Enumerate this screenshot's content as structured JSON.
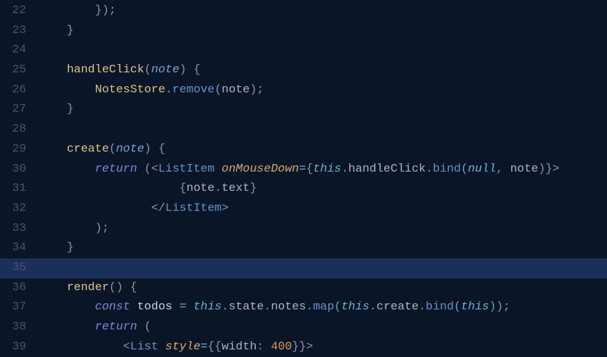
{
  "editor": {
    "first_line_number": 22,
    "highlighted_line_index": 13,
    "lines": [
      [
        {
          "t": "        });",
          "c": "tk-punc"
        }
      ],
      [
        {
          "t": "    }",
          "c": "tk-brace"
        }
      ],
      [],
      [
        {
          "t": "    ",
          "c": "tk-default"
        },
        {
          "t": "handleClick",
          "c": "tk-func"
        },
        {
          "t": "(",
          "c": "tk-punc"
        },
        {
          "t": "note",
          "c": "tk-param"
        },
        {
          "t": ") {",
          "c": "tk-punc"
        }
      ],
      [
        {
          "t": "        ",
          "c": "tk-default"
        },
        {
          "t": "NotesStore",
          "c": "tk-class"
        },
        {
          "t": ".",
          "c": "tk-punc"
        },
        {
          "t": "remove",
          "c": "tk-method"
        },
        {
          "t": "(",
          "c": "tk-punc"
        },
        {
          "t": "note",
          "c": "tk-prop"
        },
        {
          "t": ");",
          "c": "tk-punc"
        }
      ],
      [
        {
          "t": "    }",
          "c": "tk-brace"
        }
      ],
      [],
      [
        {
          "t": "    ",
          "c": "tk-default"
        },
        {
          "t": "create",
          "c": "tk-func"
        },
        {
          "t": "(",
          "c": "tk-punc"
        },
        {
          "t": "note",
          "c": "tk-param"
        },
        {
          "t": ") {",
          "c": "tk-punc"
        }
      ],
      [
        {
          "t": "        ",
          "c": "tk-default"
        },
        {
          "t": "return",
          "c": "tk-kw"
        },
        {
          "t": " (",
          "c": "tk-punc"
        },
        {
          "t": "<",
          "c": "tk-tagp"
        },
        {
          "t": "ListItem",
          "c": "tk-tag"
        },
        {
          "t": " ",
          "c": "tk-default"
        },
        {
          "t": "onMouseDown",
          "c": "tk-attr"
        },
        {
          "t": "=",
          "c": "tk-op"
        },
        {
          "t": "{",
          "c": "tk-punc"
        },
        {
          "t": "this",
          "c": "tk-this"
        },
        {
          "t": ".",
          "c": "tk-punc"
        },
        {
          "t": "handleClick",
          "c": "tk-prop"
        },
        {
          "t": ".",
          "c": "tk-punc"
        },
        {
          "t": "bind",
          "c": "tk-method"
        },
        {
          "t": "(",
          "c": "tk-punc"
        },
        {
          "t": "null",
          "c": "tk-null"
        },
        {
          "t": ", ",
          "c": "tk-punc"
        },
        {
          "t": "note",
          "c": "tk-prop"
        },
        {
          "t": ")}",
          "c": "tk-punc"
        },
        {
          "t": ">",
          "c": "tk-tagp"
        }
      ],
      [
        {
          "t": "                    {",
          "c": "tk-punc"
        },
        {
          "t": "note",
          "c": "tk-prop"
        },
        {
          "t": ".",
          "c": "tk-punc"
        },
        {
          "t": "text",
          "c": "tk-prop"
        },
        {
          "t": "}",
          "c": "tk-punc"
        }
      ],
      [
        {
          "t": "                ",
          "c": "tk-default"
        },
        {
          "t": "</",
          "c": "tk-tagp"
        },
        {
          "t": "ListItem",
          "c": "tk-tag"
        },
        {
          "t": ">",
          "c": "tk-tagp"
        }
      ],
      [
        {
          "t": "        );",
          "c": "tk-punc"
        }
      ],
      [
        {
          "t": "    }",
          "c": "tk-brace"
        }
      ],
      [],
      [
        {
          "t": "    ",
          "c": "tk-default"
        },
        {
          "t": "render",
          "c": "tk-func"
        },
        {
          "t": "() {",
          "c": "tk-punc"
        }
      ],
      [
        {
          "t": "        ",
          "c": "tk-default"
        },
        {
          "t": "const",
          "c": "tk-const"
        },
        {
          "t": " ",
          "c": "tk-default"
        },
        {
          "t": "todos",
          "c": "tk-var"
        },
        {
          "t": " ",
          "c": "tk-default"
        },
        {
          "t": "=",
          "c": "tk-op"
        },
        {
          "t": " ",
          "c": "tk-default"
        },
        {
          "t": "this",
          "c": "tk-this"
        },
        {
          "t": ".",
          "c": "tk-punc"
        },
        {
          "t": "state",
          "c": "tk-prop"
        },
        {
          "t": ".",
          "c": "tk-punc"
        },
        {
          "t": "notes",
          "c": "tk-prop"
        },
        {
          "t": ".",
          "c": "tk-punc"
        },
        {
          "t": "map",
          "c": "tk-method"
        },
        {
          "t": "(",
          "c": "tk-punc"
        },
        {
          "t": "this",
          "c": "tk-this"
        },
        {
          "t": ".",
          "c": "tk-punc"
        },
        {
          "t": "create",
          "c": "tk-prop"
        },
        {
          "t": ".",
          "c": "tk-punc"
        },
        {
          "t": "bind",
          "c": "tk-method"
        },
        {
          "t": "(",
          "c": "tk-punc"
        },
        {
          "t": "this",
          "c": "tk-this"
        },
        {
          "t": "));",
          "c": "tk-punc"
        }
      ],
      [
        {
          "t": "        ",
          "c": "tk-default"
        },
        {
          "t": "return",
          "c": "tk-kw"
        },
        {
          "t": " (",
          "c": "tk-punc"
        }
      ],
      [
        {
          "t": "            ",
          "c": "tk-default"
        },
        {
          "t": "<",
          "c": "tk-tagp"
        },
        {
          "t": "List",
          "c": "tk-tag"
        },
        {
          "t": " ",
          "c": "tk-default"
        },
        {
          "t": "style",
          "c": "tk-attr"
        },
        {
          "t": "=",
          "c": "tk-op"
        },
        {
          "t": "{{",
          "c": "tk-punc"
        },
        {
          "t": "width",
          "c": "tk-prop"
        },
        {
          "t": ": ",
          "c": "tk-punc"
        },
        {
          "t": "400",
          "c": "tk-num"
        },
        {
          "t": "}}",
          "c": "tk-punc"
        },
        {
          "t": ">",
          "c": "tk-tagp"
        }
      ]
    ]
  }
}
